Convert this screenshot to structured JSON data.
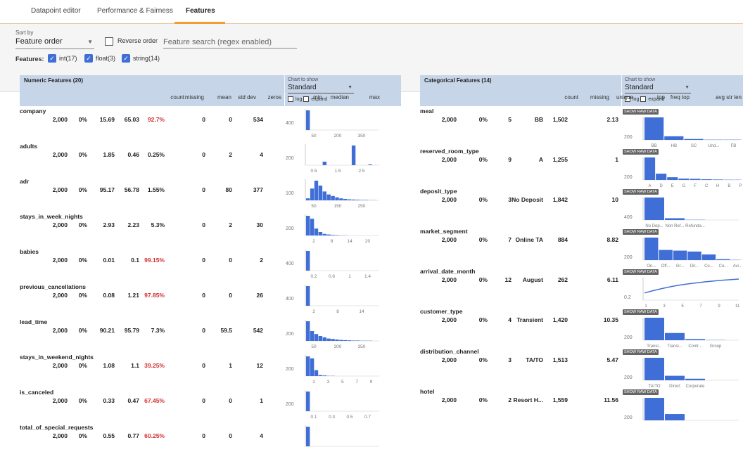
{
  "tabs": [
    "Datapoint editor",
    "Performance & Fairness",
    "Features"
  ],
  "controls": {
    "sort_by_label": "Sort by",
    "sort_value": "Feature order",
    "reverse_label": "Reverse order",
    "search_placeholder": "Feature search (regex enabled)",
    "features_label": "Features:",
    "types": [
      "int(17)",
      "float(3)",
      "string(14)"
    ]
  },
  "numeric": {
    "title": "Numeric Features (20)",
    "chart_to_show": "Chart to show",
    "chart_mode": "Standard",
    "log_label": "log",
    "expand_label": "expand",
    "columns": [
      "count",
      "missing",
      "mean",
      "std dev",
      "zeros",
      "min",
      "median",
      "max"
    ],
    "rows": [
      {
        "name": "company",
        "count": "2,000",
        "missing": "0%",
        "mean": "15.69",
        "std": "65.03",
        "zeros": "92.7%",
        "zeros_red": true,
        "min": "0",
        "median": "0",
        "max": "534",
        "ytick": "400",
        "xticks": [
          "50",
          "200",
          "350",
          "500"
        ],
        "bars": [
          1.0,
          0,
          0,
          0,
          0,
          0,
          0,
          0,
          0,
          0,
          0,
          0,
          0,
          0,
          0,
          0,
          0,
          0,
          0,
          0.02
        ]
      },
      {
        "name": "adults",
        "count": "2,000",
        "missing": "0%",
        "mean": "1.85",
        "std": "0.46",
        "zeros": "0.25%",
        "zeros_red": false,
        "min": "0",
        "median": "2",
        "max": "4",
        "ytick": "200",
        "xticks": [
          "0.5",
          "1.5",
          "2.5",
          "3.5"
        ],
        "bars": [
          0,
          0,
          0,
          0,
          0.18,
          0,
          0,
          0,
          0,
          0,
          0,
          1.0,
          0,
          0,
          0,
          0.04,
          0,
          0,
          0,
          0
        ]
      },
      {
        "name": "adr",
        "count": "2,000",
        "missing": "0%",
        "mean": "95.17",
        "std": "56.78",
        "zeros": "1.55%",
        "zeros_red": false,
        "min": "0",
        "median": "80",
        "max": "377",
        "ytick": "100",
        "xticks": [
          "50",
          "150",
          "250",
          "350"
        ],
        "bars": [
          0.1,
          0.6,
          1.0,
          0.75,
          0.45,
          0.3,
          0.22,
          0.15,
          0.1,
          0.07,
          0.05,
          0.04,
          0.03,
          0.02,
          0.02,
          0.01,
          0.01,
          0,
          0,
          0.01
        ]
      },
      {
        "name": "stays_in_week_nights",
        "count": "2,000",
        "missing": "0%",
        "mean": "2.93",
        "std": "2.23",
        "zeros": "5.3%",
        "zeros_red": false,
        "min": "0",
        "median": "2",
        "max": "30",
        "ytick": "200",
        "xticks": [
          "2",
          "8",
          "14",
          "20",
          "26"
        ],
        "bars": [
          1.0,
          0.85,
          0.35,
          0.18,
          0.08,
          0.05,
          0.03,
          0.02,
          0.01,
          0.01,
          0,
          0,
          0,
          0,
          0,
          0,
          0,
          0,
          0,
          0
        ]
      },
      {
        "name": "babies",
        "count": "2,000",
        "missing": "0%",
        "mean": "0.01",
        "std": "0.1",
        "zeros": "99.15%",
        "zeros_red": true,
        "min": "0",
        "median": "0",
        "max": "2",
        "ytick": "400",
        "xticks": [
          "0.2",
          "0.6",
          "1",
          "1.4",
          "1.8"
        ],
        "bars": [
          1.0,
          0,
          0,
          0,
          0,
          0,
          0,
          0,
          0,
          0,
          0,
          0,
          0,
          0,
          0,
          0,
          0,
          0,
          0,
          0
        ]
      },
      {
        "name": "previous_cancellations",
        "count": "2,000",
        "missing": "0%",
        "mean": "0.08",
        "std": "1.21",
        "zeros": "97.85%",
        "zeros_red": true,
        "min": "0",
        "median": "0",
        "max": "26",
        "ytick": "400",
        "xticks": [
          "2",
          "8",
          "14",
          "20"
        ],
        "bars": [
          1.0,
          0,
          0,
          0,
          0,
          0,
          0,
          0,
          0,
          0,
          0,
          0,
          0,
          0,
          0,
          0,
          0,
          0,
          0,
          0
        ]
      },
      {
        "name": "lead_time",
        "count": "2,000",
        "missing": "0%",
        "mean": "90.21",
        "std": "95.79",
        "zeros": "7.3%",
        "zeros_red": false,
        "min": "0",
        "median": "59.5",
        "max": "542",
        "ytick": "200",
        "xticks": [
          "50",
          "200",
          "350",
          "500"
        ],
        "bars": [
          1.0,
          0.5,
          0.35,
          0.25,
          0.18,
          0.12,
          0.1,
          0.07,
          0.05,
          0.04,
          0.03,
          0.02,
          0.02,
          0.01,
          0.01,
          0.01,
          0,
          0,
          0,
          0
        ]
      },
      {
        "name": "stays_in_weekend_nights",
        "count": "2,000",
        "missing": "0%",
        "mean": "1.08",
        "std": "1.1",
        "zeros": "39.25%",
        "zeros_red": true,
        "min": "0",
        "median": "1",
        "max": "12",
        "ytick": "200",
        "xticks": [
          "1",
          "3",
          "5",
          "7",
          "9",
          "11"
        ],
        "bars": [
          1.0,
          0.9,
          0.3,
          0.05,
          0.03,
          0.01,
          0.01,
          0,
          0,
          0,
          0,
          0,
          0,
          0,
          0,
          0,
          0,
          0,
          0,
          0
        ]
      },
      {
        "name": "is_canceled",
        "count": "2,000",
        "missing": "0%",
        "mean": "0.33",
        "std": "0.47",
        "zeros": "67.45%",
        "zeros_red": true,
        "min": "0",
        "median": "0",
        "max": "1",
        "ytick": "200",
        "xticks": [
          "0.1",
          "0.3",
          "0.5",
          "0.7",
          "0.9"
        ],
        "bars": [
          1.0,
          0,
          0,
          0,
          0,
          0,
          0,
          0,
          0,
          0,
          0,
          0,
          0,
          0,
          0,
          0,
          0,
          0,
          0,
          0.5
        ]
      },
      {
        "name": "total_of_special_requests",
        "count": "2,000",
        "missing": "0%",
        "mean": "0.55",
        "std": "0.77",
        "zeros": "60.25%",
        "zeros_red": true,
        "min": "0",
        "median": "0",
        "max": "4",
        "ytick": "",
        "xticks": [],
        "bars": [
          1.0,
          0,
          0,
          0,
          0,
          0,
          0,
          0,
          0,
          0,
          0,
          0,
          0,
          0,
          0,
          0,
          0,
          0,
          0,
          0
        ]
      }
    ]
  },
  "categorical": {
    "title": "Categorical Features (14)",
    "chart_to_show": "Chart to show",
    "chart_mode": "Standard",
    "log_label": "log",
    "expand_label": "expand",
    "raw_label": "SHOW RAW DATA",
    "columns": [
      "count",
      "missing",
      "unique",
      "top",
      "freq top",
      "avg str len"
    ],
    "rows": [
      {
        "name": "meal",
        "count": "2,000",
        "missing": "0%",
        "unique": "5",
        "top": "BB",
        "freq": "1,502",
        "avglen": "2.13",
        "ytick": "200",
        "labels": [
          "BB",
          "HB",
          "SC",
          "Und...",
          "FB"
        ],
        "bars": [
          1.0,
          0.16,
          0.04,
          0.01,
          0.01
        ],
        "kind": "bar"
      },
      {
        "name": "reserved_room_type",
        "count": "2,000",
        "missing": "0%",
        "unique": "9",
        "top": "A",
        "freq": "1,255",
        "avglen": "1",
        "ytick": "200",
        "labels": [
          "A",
          "D",
          "E",
          "G",
          "F",
          "C",
          "H",
          "B",
          "P"
        ],
        "bars": [
          1.0,
          0.28,
          0.12,
          0.06,
          0.05,
          0.03,
          0.02,
          0.01,
          0.01
        ],
        "kind": "bar"
      },
      {
        "name": "deposit_type",
        "count": "2,000",
        "missing": "0%",
        "unique": "3",
        "top": "No Deposit",
        "freq": "1,842",
        "avglen": "10",
        "ytick": "400",
        "labels": [
          "No Dep...",
          "Non Ref...",
          "Refunda..."
        ],
        "bars": [
          1.0,
          0.08,
          0.01
        ],
        "kind": "bar"
      },
      {
        "name": "market_segment",
        "count": "2,000",
        "missing": "0%",
        "unique": "7",
        "top": "Online TA",
        "freq": "884",
        "avglen": "8.82",
        "ytick": "200",
        "labels": [
          "On...",
          "Off...",
          "Gr...",
          "Dir...",
          "Co...",
          "Co...",
          "Avi..."
        ],
        "bars": [
          1.0,
          0.45,
          0.42,
          0.38,
          0.25,
          0.04,
          0.01
        ],
        "kind": "bar"
      },
      {
        "name": "arrival_date_month",
        "count": "2,000",
        "missing": "0%",
        "unique": "12",
        "top": "August",
        "freq": "262",
        "avglen": "6.11",
        "ytick": "0.2",
        "labels": [
          "1",
          "3",
          "5",
          "7",
          "9",
          "11"
        ],
        "bars": [
          0.1,
          0.25,
          0.38,
          0.5,
          0.6,
          0.68,
          0.75,
          0.82,
          0.87,
          0.92,
          0.96,
          1.0
        ],
        "kind": "line"
      },
      {
        "name": "customer_type",
        "count": "2,000",
        "missing": "0%",
        "unique": "4",
        "top": "Transient",
        "freq": "1,420",
        "avglen": "10.35",
        "ytick": "200",
        "labels": [
          "Transi...",
          "Transi...",
          "Contr...",
          "Group"
        ],
        "bars": [
          1.0,
          0.32,
          0.05,
          0.01
        ],
        "kind": "bar"
      },
      {
        "name": "distribution_channel",
        "count": "2,000",
        "missing": "0%",
        "unique": "3",
        "top": "TA/TO",
        "freq": "1,513",
        "avglen": "5.47",
        "ytick": "200",
        "labels": [
          "TA/TO",
          "Direct",
          "Corporate"
        ],
        "bars": [
          1.0,
          0.2,
          0.07
        ],
        "kind": "bar"
      },
      {
        "name": "hotel",
        "count": "2,000",
        "missing": "0%",
        "unique": "2",
        "top": "Resort H...",
        "freq": "1,559",
        "avglen": "11.56",
        "ytick": "200",
        "labels": [],
        "bars": [
          1.0,
          0.28
        ],
        "kind": "bar"
      }
    ]
  },
  "colors": {
    "bar": "#3f6fd6",
    "header": "#c6d5e8",
    "accent": "#f39c32",
    "red": "#d32f2f"
  }
}
